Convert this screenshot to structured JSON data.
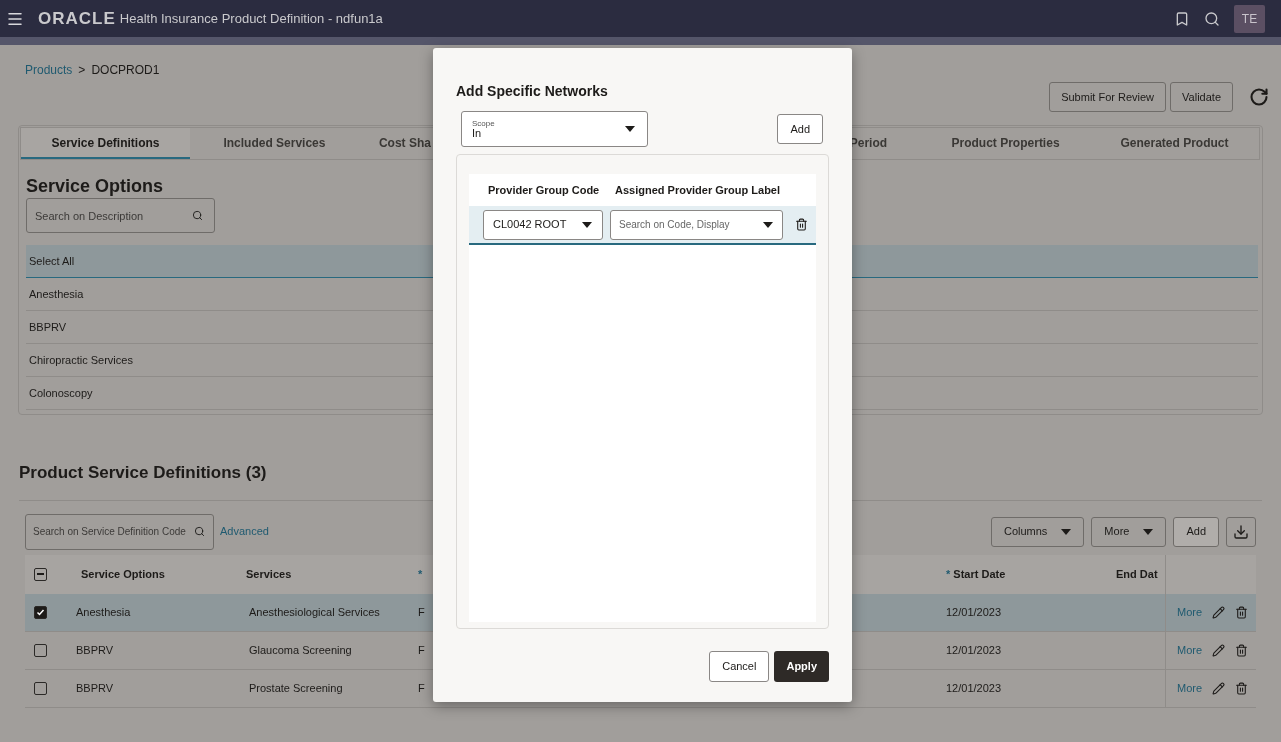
{
  "header": {
    "logo": "ORACLE",
    "title": "Health Insurance Product Definition - ndfun1a",
    "avatar": "TE"
  },
  "breadcrumb": {
    "items": [
      {
        "label": "Products",
        "link": true
      },
      {
        "label": "DOCPROD1",
        "link": false
      }
    ],
    "separator": ">"
  },
  "page_actions": [
    "Submit For Review",
    "Validate"
  ],
  "tabs": [
    {
      "label": "Service Definitions",
      "selected": true,
      "kind": "full"
    },
    {
      "label": "Included Services",
      "selected": false,
      "kind": "full"
    },
    {
      "label": "Cost Sha",
      "selected": false,
      "kind": "clipped_end"
    },
    {
      "label": "Period",
      "selected": false,
      "kind": "clipped_start"
    },
    {
      "label": "Product Properties",
      "selected": false,
      "kind": "full"
    },
    {
      "label": "Generated Product",
      "selected": false,
      "kind": "full"
    }
  ],
  "service_options": {
    "title": "Service Options",
    "search": {
      "placeholder": "Search on Description"
    },
    "items": [
      {
        "label": "Select All",
        "selected": true
      },
      {
        "label": "Anesthesia",
        "selected": false
      },
      {
        "label": "BBPRV",
        "selected": false
      },
      {
        "label": "Chiropractic Services",
        "selected": false
      },
      {
        "label": "Colonoscopy",
        "selected": false
      }
    ]
  },
  "product_service_definitions": {
    "title": "Product Service Definitions (3)",
    "search": {
      "placeholder": "Search on Service Definition Code"
    },
    "advanced_link": "Advanced",
    "toolbar": [
      {
        "label": "Columns",
        "kind": "menu"
      },
      {
        "label": "More",
        "kind": "menu"
      },
      {
        "label": "Add",
        "kind": "button"
      },
      {
        "kind": "download"
      }
    ],
    "header_checkbox": {
      "indeterminate": true
    },
    "columns": [
      {
        "label": "Service Options"
      },
      {
        "label": "Services"
      },
      {
        "required_mark": "*"
      },
      {
        "label": "Start Date",
        "required_mark": "*"
      },
      {
        "label": "End Dat"
      }
    ],
    "rows": [
      {
        "checked": true,
        "selected": true,
        "service_option": "Anesthesia",
        "service": "Anesthesiological Services",
        "column_3": "F",
        "start_date": "12/01/2023",
        "more": "More"
      },
      {
        "checked": false,
        "selected": false,
        "service_option": "BBPRV",
        "service": "Glaucoma Screening",
        "column_3": "F",
        "start_date": "12/01/2023",
        "more": "More"
      },
      {
        "checked": false,
        "selected": false,
        "service_option": "BBPRV",
        "service": "Prostate Screening",
        "column_3": "F",
        "start_date": "12/01/2023",
        "more": "More"
      }
    ]
  },
  "dialog": {
    "title": "Add Specific Networks",
    "scope": {
      "label": "Scope",
      "value": "In"
    },
    "add_button": "Add",
    "columns": [
      "Provider Group Code",
      "Assigned Provider Group Label"
    ],
    "rows": [
      {
        "provider_group_code": "CL0042 ROOT",
        "label_placeholder": "Search on Code, Display",
        "selected": true
      }
    ],
    "buttons": [
      {
        "label": "Cancel",
        "kind": "secondary"
      },
      {
        "label": "Apply",
        "kind": "primary"
      }
    ]
  }
}
